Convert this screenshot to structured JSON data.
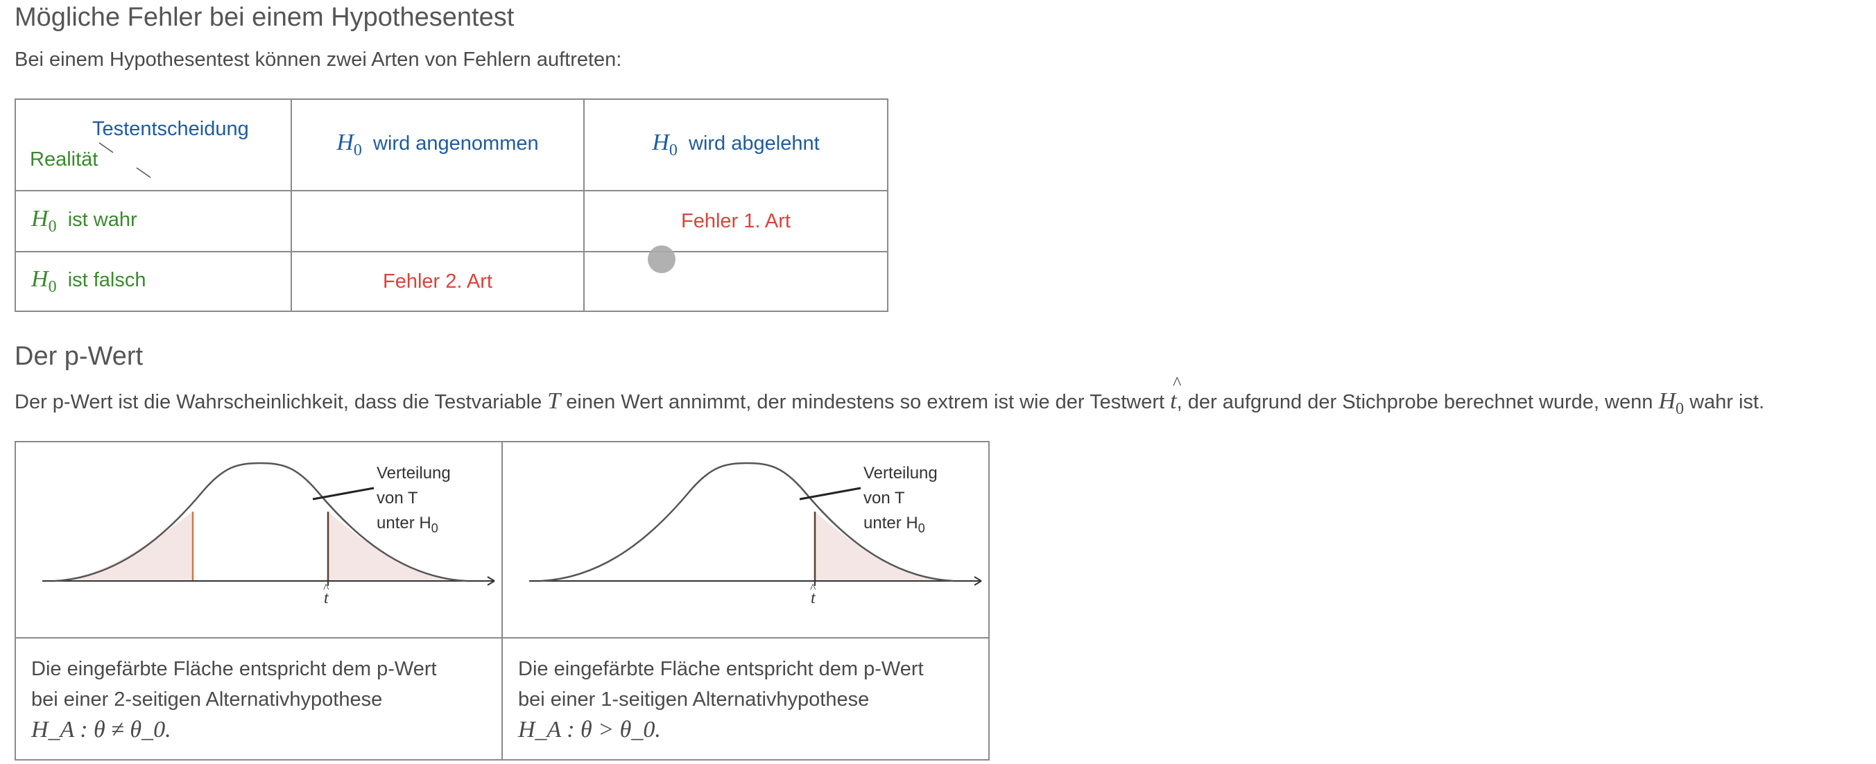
{
  "section1": {
    "title": "Mögliche Fehler bei einem Hypothesentest",
    "intro": "Bei einem Hypothesentest können zwei Arten von Fehlern auftreten:"
  },
  "error_table": {
    "corner_top": "Testentscheidung",
    "corner_bottom": "Realität",
    "h0_symbol": "H",
    "h0_sub": "0",
    "col1": "wird angenommen",
    "col2": "wird abgelehnt",
    "row1": "ist wahr",
    "row2": "ist falsch",
    "cell_r1c2": "Fehler 1. Art",
    "cell_r2c1": "Fehler 2. Art"
  },
  "section2": {
    "title": "Der p-Wert",
    "text_part1": "Der p-Wert ist die Wahrscheinlichkeit, dass die Testvariable",
    "var_T": "T",
    "text_part2": "einen Wert annimmt, der mindestens so extrem ist wie der Testwert",
    "var_t": "t",
    "text_part3": ", der aufgrund der Stichprobe berechnet wurde, wenn",
    "text_part4": "wahr ist."
  },
  "figures": {
    "dist_label_line1": "Verteilung",
    "dist_label_line2": "von T",
    "dist_label_line3": "unter H",
    "dist_label_sub": "0",
    "t_hat": "t",
    "left_caption_line1": "Die eingefärbte Fläche entspricht dem p-Wert",
    "left_caption_line2": "bei einer 2-seitigen Alternativhypothese",
    "left_formula": "H_A : θ ≠ θ_0.",
    "right_caption_line1": "Die eingefärbte Fläche entspricht dem p-Wert",
    "right_caption_line2": "bei einer 1-seitigen Alternativhypothese",
    "right_formula": "H_A : θ > θ_0."
  },
  "colors": {
    "heading": "#555555",
    "blue": "#1f5b9e",
    "green": "#3a8a2e",
    "red": "#d9443a",
    "fill": "#f3e6e4",
    "fill_edge": "#c77a46"
  }
}
